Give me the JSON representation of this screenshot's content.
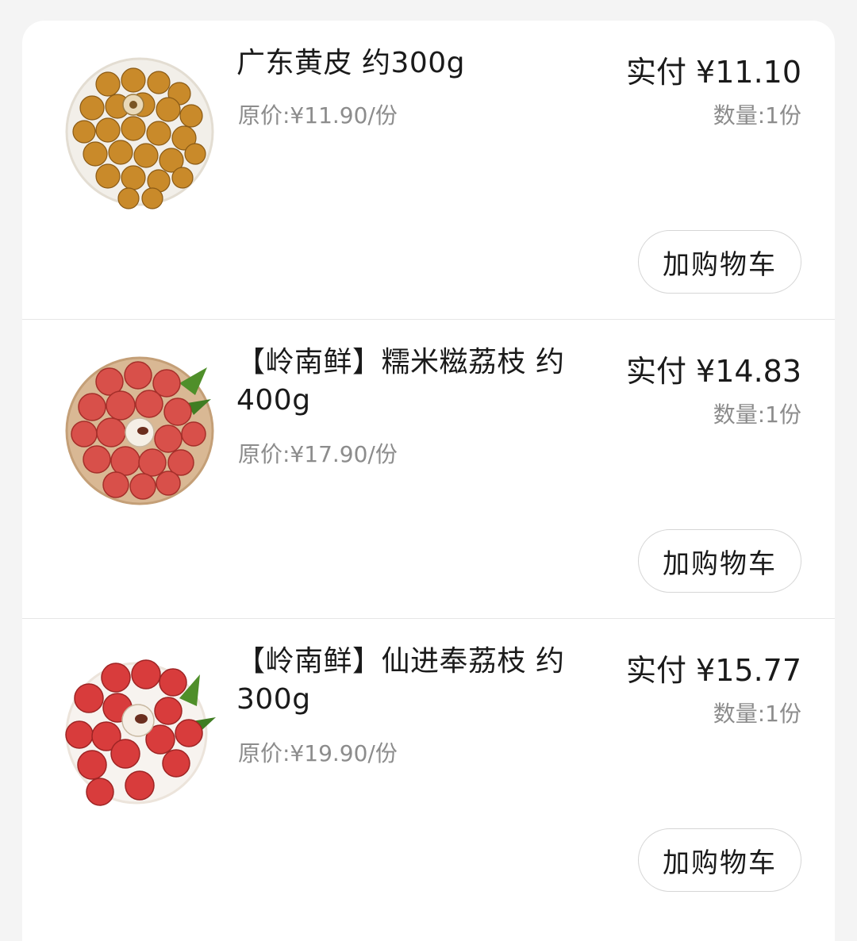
{
  "items": [
    {
      "title": "广东黄皮 约300g",
      "original_price": "原价:¥11.90/份",
      "paid": "实付 ¥11.10",
      "quantity": "数量:1份",
      "button": "加购物车",
      "image": "wampee-fruit-plate"
    },
    {
      "title": "【岭南鲜】糯米糍荔枝 约 400g",
      "original_price": "原价:¥17.90/份",
      "paid": "实付 ¥14.83",
      "quantity": "数量:1份",
      "button": "加购物车",
      "image": "lychee-plate"
    },
    {
      "title": "【岭南鲜】仙进奉荔枝 约 300g",
      "original_price": "原价:¥19.90/份",
      "paid": "实付 ¥15.77",
      "quantity": "数量:1份",
      "button": "加购物车",
      "image": "lychee-plate"
    }
  ]
}
